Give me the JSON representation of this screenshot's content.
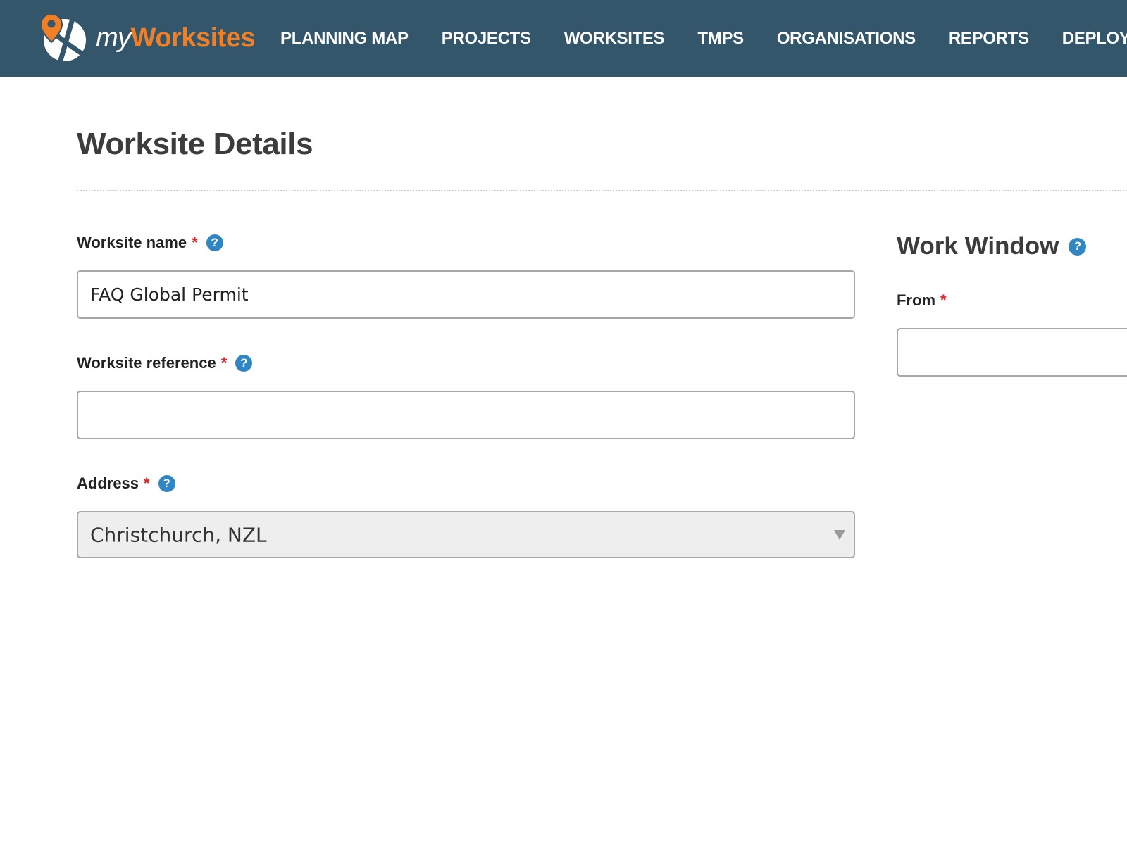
{
  "header": {
    "logo": {
      "prefix": "my",
      "suffix": "Worksites"
    },
    "nav": [
      {
        "label": "PLANNING MAP"
      },
      {
        "label": "PROJECTS"
      },
      {
        "label": "WORKSITES"
      },
      {
        "label": "TMPS"
      },
      {
        "label": "ORGANISATIONS"
      },
      {
        "label": "REPORTS"
      },
      {
        "label": "DEPLOYMENTS"
      }
    ]
  },
  "page": {
    "title": "Worksite Details"
  },
  "form": {
    "worksite_name": {
      "label": "Worksite name",
      "required_marker": "*",
      "help": "?",
      "value": "FAQ Global Permit"
    },
    "worksite_reference": {
      "label": "Worksite reference",
      "required_marker": "*",
      "help": "?",
      "value": ""
    },
    "address": {
      "label": "Address",
      "required_marker": "*",
      "help": "?",
      "selected": "Christchurch, NZL"
    }
  },
  "work_window": {
    "title": "Work Window",
    "help": "?",
    "from": {
      "label": "From",
      "required_marker": "*",
      "value": ""
    }
  },
  "colors": {
    "header_bg": "#34566b",
    "brand_orange": "#f07f26",
    "help_blue": "#2f86c2",
    "required_red": "#e02424"
  },
  "icons": {
    "logo": "map-pin-globe-icon",
    "help": "question-circle-icon",
    "select": "caret-down-icon"
  }
}
